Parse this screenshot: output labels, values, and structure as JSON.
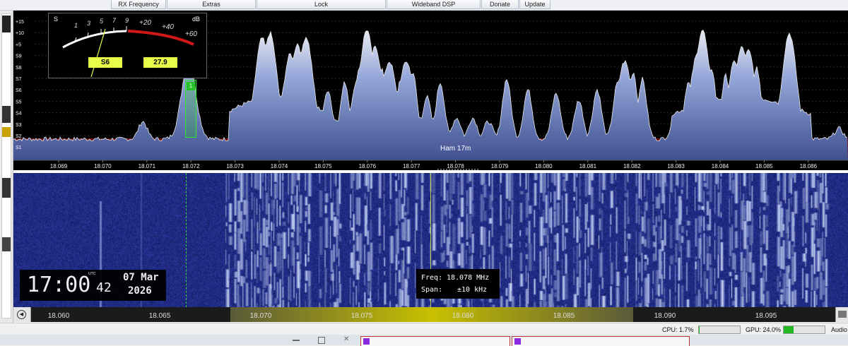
{
  "toolbar": {
    "tabs": [
      {
        "label": "RX Frequency"
      },
      {
        "label": "Extras"
      },
      {
        "label": "Lock"
      },
      {
        "label": "Wideband DSP"
      },
      {
        "label": "Donate"
      },
      {
        "label": "Update"
      }
    ]
  },
  "smeter": {
    "s_label": "S",
    "db_label": "dB",
    "s_scale": [
      "1",
      "3",
      "5",
      "7",
      "9"
    ],
    "db_scale": [
      "+20",
      "+40",
      "+60"
    ],
    "s_reading": "S6",
    "db_reading": "27.9"
  },
  "spectrum": {
    "y_labels": [
      "+15",
      "+10",
      "+5",
      "S9",
      "S8",
      "S7",
      "S6",
      "S5",
      "S4",
      "S3",
      "S2",
      "S1"
    ],
    "x_labels": [
      "18.069",
      "18.070",
      "18.071",
      "18.072",
      "18.073",
      "18.074",
      "18.075",
      "18.076",
      "18.077",
      "18.078",
      "18.079",
      "18.080",
      "18.081",
      "18.082",
      "18.083",
      "18.084",
      "18.085",
      "18.086"
    ],
    "band_label": "Ham 17m",
    "marker_label": "1"
  },
  "waterfall": {
    "clock_time": "17:00",
    "clock_seconds": "42",
    "clock_utc": "UTC",
    "clock_date": "07 Mar",
    "clock_year": "2026",
    "freq_label": "Freq:",
    "freq_value": "18.078 MHz",
    "span_label": "Span:",
    "span_value": "±10 kHz"
  },
  "bottom_axis": {
    "labels": [
      "18.060",
      "18.065",
      "18.070",
      "18.075",
      "18.080",
      "18.085",
      "18.090",
      "18.095"
    ]
  },
  "status": {
    "cpu_label": "CPU: 1.7%",
    "cpu_fraction": 0.017,
    "gpu_label": "GPU: 24.0%",
    "gpu_fraction": 0.24,
    "audio_label": "Audio"
  },
  "colors": {
    "spectrum_fill": "#6f86c8",
    "noise_floor": "#6b0f0f",
    "waterfall_bg": "#1a2270",
    "signal": "#dfeaff",
    "meter_readout": "#e8ff4a"
  }
}
